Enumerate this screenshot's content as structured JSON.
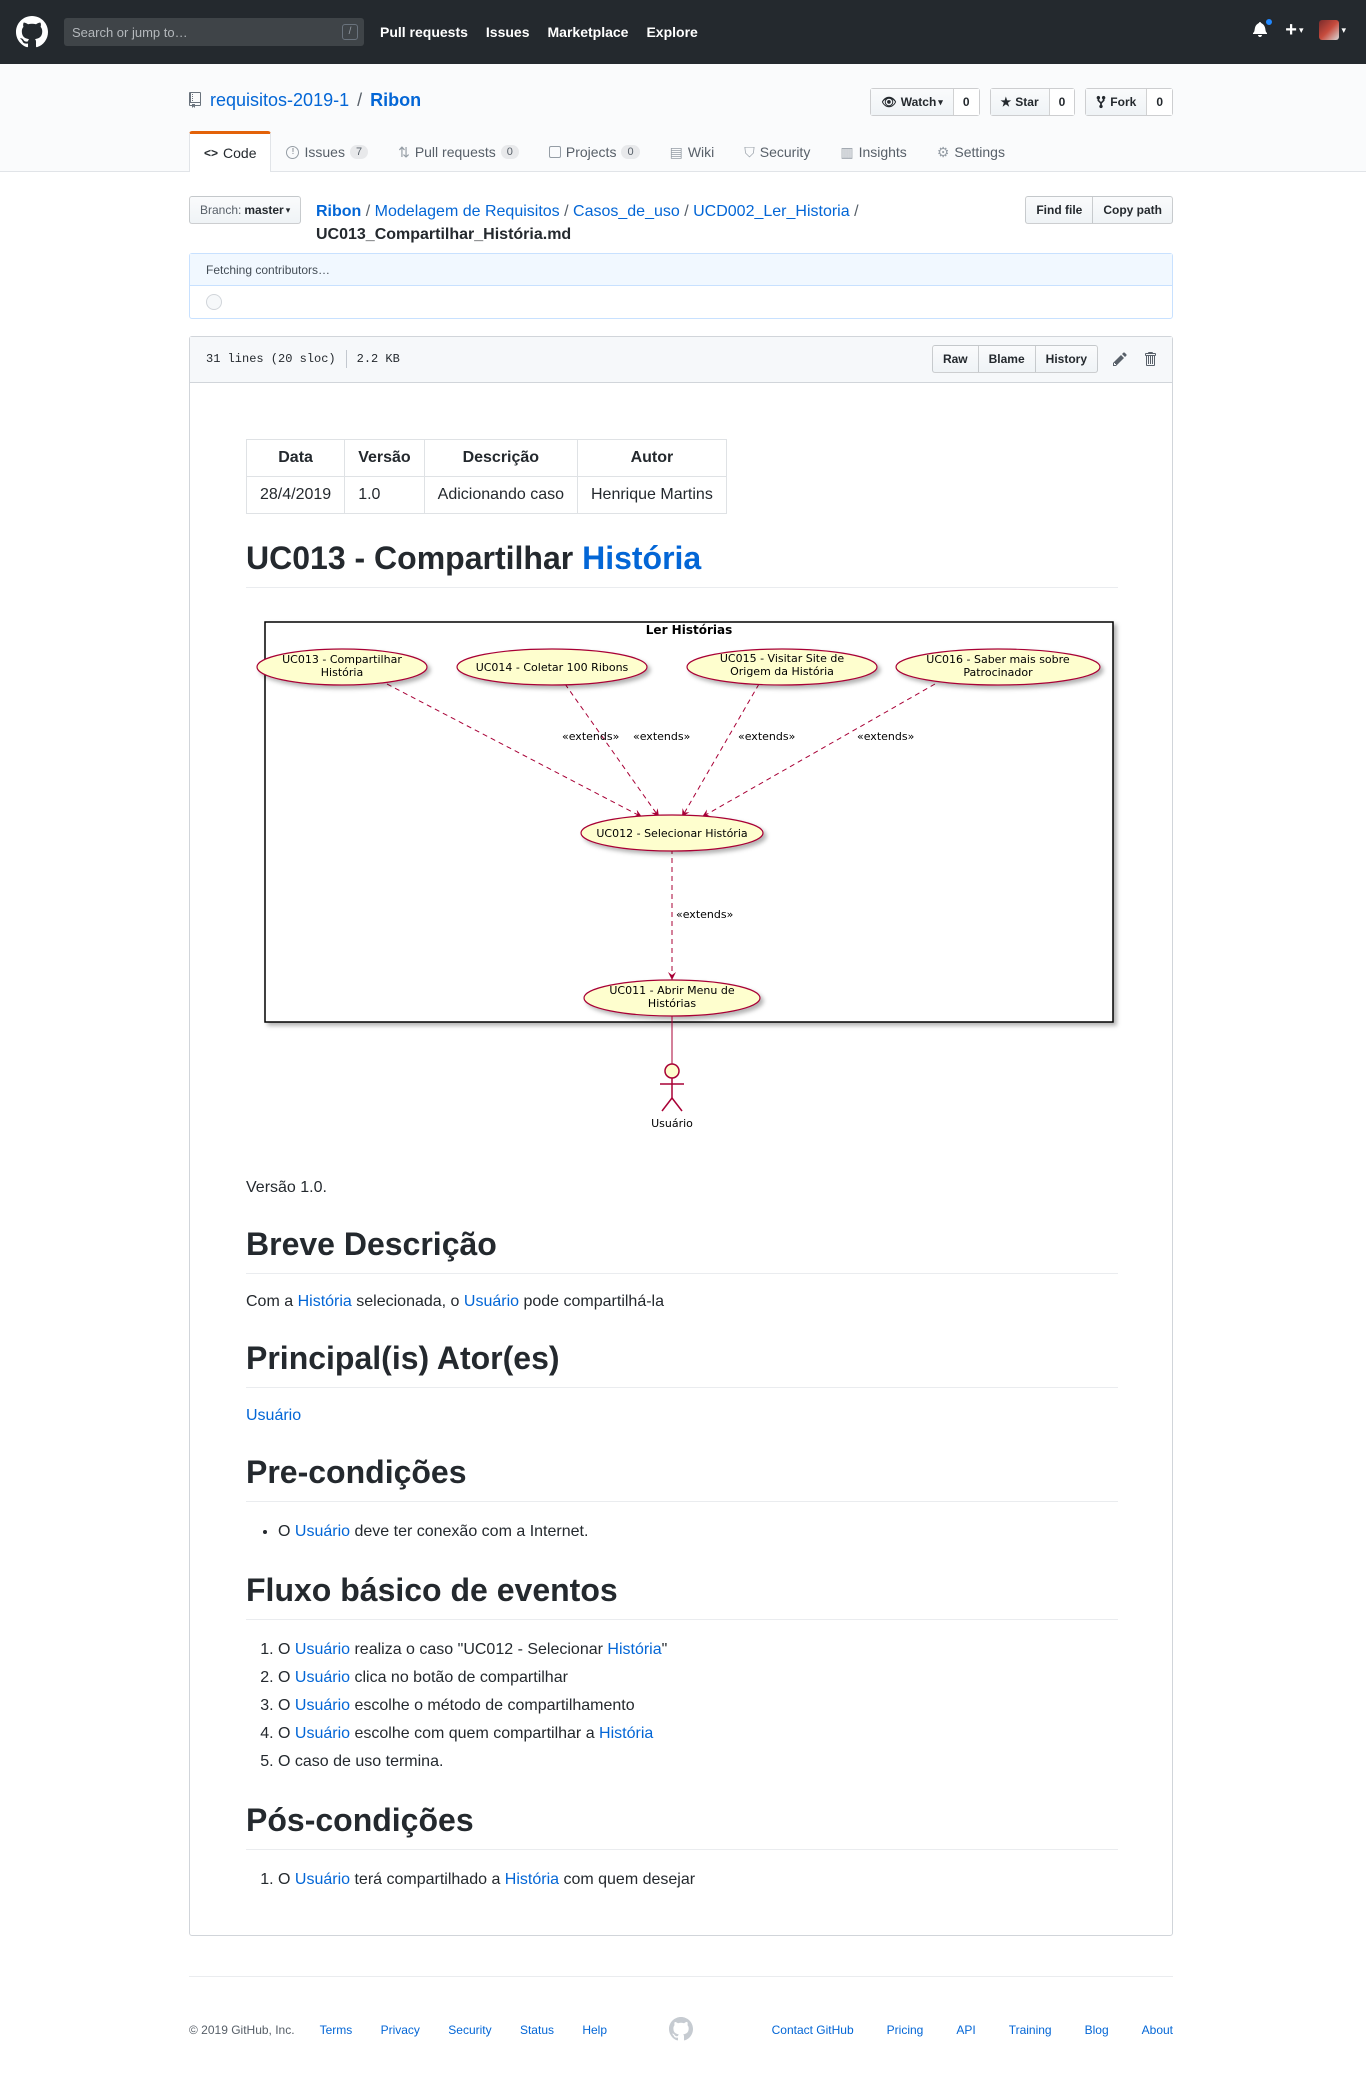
{
  "header": {
    "search_placeholder": "Search or jump to…",
    "slash_key": "/",
    "nav": [
      "Pull requests",
      "Issues",
      "Marketplace",
      "Explore"
    ]
  },
  "repo": {
    "owner": "requisitos-2019-1",
    "separator": "/",
    "name": "Ribon",
    "watch_label": "Watch",
    "watch_count": "0",
    "star_label": "Star",
    "star_count": "0",
    "fork_label": "Fork",
    "fork_count": "0"
  },
  "tabs": [
    {
      "label": "Code",
      "icon": "code-icon"
    },
    {
      "label": "Issues",
      "count": "7",
      "icon": "issue-icon"
    },
    {
      "label": "Pull requests",
      "count": "0",
      "icon": "pull-request-icon"
    },
    {
      "label": "Projects",
      "count": "0",
      "icon": "project-icon"
    },
    {
      "label": "Wiki",
      "icon": "book-icon"
    },
    {
      "label": "Security",
      "icon": "shield-icon"
    },
    {
      "label": "Insights",
      "icon": "graph-icon"
    },
    {
      "label": "Settings",
      "icon": "gear-icon"
    }
  ],
  "file_nav": {
    "branch_label": "Branch:",
    "branch": "master",
    "path": [
      "Ribon",
      "Modelagem de Requisitos",
      "Casos_de_uso",
      "UCD002_Ler_Historia"
    ],
    "filename": "UC013_Compartilhar_História.md",
    "find_file": "Find file",
    "copy_path": "Copy path"
  },
  "commit_tease": {
    "text": "Fetching contributors…"
  },
  "file_header": {
    "lines": "31 lines (20 sloc)",
    "size": "2.2 KB",
    "raw": "Raw",
    "blame": "Blame",
    "history": "History"
  },
  "version_table": {
    "headers": [
      "Data",
      "Versão",
      "Descrição",
      "Autor"
    ],
    "rows": [
      [
        "28/4/2019",
        "1.0",
        "Adicionando caso",
        "Henrique Martins"
      ]
    ]
  },
  "content": {
    "title_prefix": "UC013 - Compartilhar ",
    "title_link": "História",
    "version_text": "Versão 1.0.",
    "h_desc": "Breve Descrição",
    "desc_1": "Com a ",
    "desc_link1": "História",
    "desc_2": " selecionada, o ",
    "desc_link2": "Usuário",
    "desc_3": " pode compartilhá-la",
    "h_actors": "Principal(is) Ator(es)",
    "actor_link": "Usuário",
    "h_pre": "Pre-condições",
    "pre_1": "O ",
    "pre_link": "Usuário",
    "pre_2": " deve ter conexão com a Internet.",
    "h_flow": "Fluxo básico de eventos",
    "flow": [
      {
        "a": "O ",
        "l1": "Usuário",
        "b": " realiza o caso \"UC012 - Selecionar ",
        "l2": "História",
        "c": "\""
      },
      {
        "a": "O ",
        "l1": "Usuário",
        "b": " clica no botão de compartilhar"
      },
      {
        "a": "O ",
        "l1": "Usuário",
        "b": " escolhe o método de compartilhamento"
      },
      {
        "a": "O ",
        "l1": "Usuário",
        "b": " escolhe com quem compartilhar a ",
        "l2": "História"
      },
      {
        "a": "O caso de uso termina."
      }
    ],
    "h_post": "Pós-condições",
    "post_1": "O ",
    "post_link1": "Usuário",
    "post_2": " terá compartilhado a ",
    "post_link2": "História",
    "post_3": " com quem desejar"
  },
  "diagram": {
    "package": "Ler Histórias",
    "uc013": [
      "UC013 - Compartilhar",
      "História"
    ],
    "uc014": "UC014 - Coletar 100 Ribons",
    "uc015": [
      "UC015 - Visitar Site de",
      "Origem da História"
    ],
    "uc016": [
      "UC016 - Saber mais sobre",
      "Patrocinador"
    ],
    "uc012": "UC012 - Selecionar História",
    "uc011": [
      "UC011 - Abrir Menu de",
      "Histórias"
    ],
    "extends": "«extends»",
    "actor": "Usuário",
    "colors": {
      "usecase_fill": "#fefece",
      "border": "#a80036"
    }
  },
  "footer": {
    "copyright": "© 2019 GitHub, Inc.",
    "left_links": [
      "Terms",
      "Privacy",
      "Security",
      "Status",
      "Help"
    ],
    "right_links": [
      "Contact GitHub",
      "Pricing",
      "API",
      "Training",
      "Blog",
      "About"
    ]
  }
}
